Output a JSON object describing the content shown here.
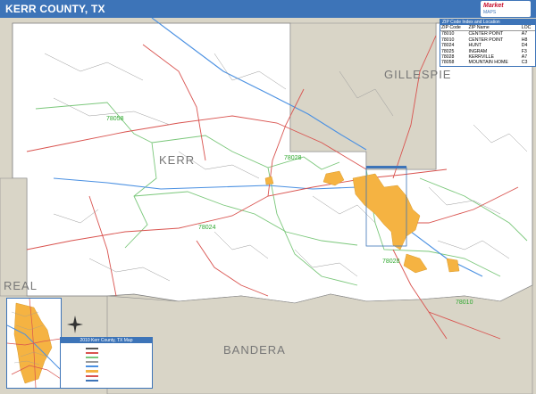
{
  "header": {
    "title": "KERR COUNTY, TX"
  },
  "colors": {
    "header_bg": "#3d74b8",
    "county_fill": "#ffffff",
    "neighbor_fill": "#d9d5c7",
    "city_fill": "#f5b342",
    "zip_boundary": "#7ac77a",
    "road_major": "#d9534f",
    "road_minor": "#9a9a9a",
    "river": "#4a90e2"
  },
  "map_labels": {
    "counties": {
      "kerr": "KERR",
      "gillespie": "GILLESPIE",
      "real": "REAL",
      "bandera": "BANDERA"
    },
    "zips": {
      "z1": "78058",
      "z2": "78028",
      "z3": "78024",
      "z4": "78028",
      "z5": "78010"
    }
  },
  "zip_table": {
    "title": "ZIP Code Index and Location",
    "headers": [
      "ZIP Code",
      "ZIP Name",
      "LOC"
    ],
    "rows": [
      [
        "78010",
        "CENTER POINT",
        "A7"
      ],
      [
        "78010",
        "CENTER POINT",
        "H8"
      ],
      [
        "78024",
        "HUNT",
        "D4"
      ],
      [
        "78025",
        "INGRAM",
        "F3"
      ],
      [
        "78028",
        "KERRVILLE",
        "A7"
      ],
      [
        "78058",
        "MOUNTAIN HOME",
        "C3"
      ]
    ]
  },
  "legend": {
    "title": "2010 Kerr County, TX Map"
  },
  "icons": {
    "compass": "compass-rose-icon",
    "logo": "publisher-logo-icon"
  }
}
